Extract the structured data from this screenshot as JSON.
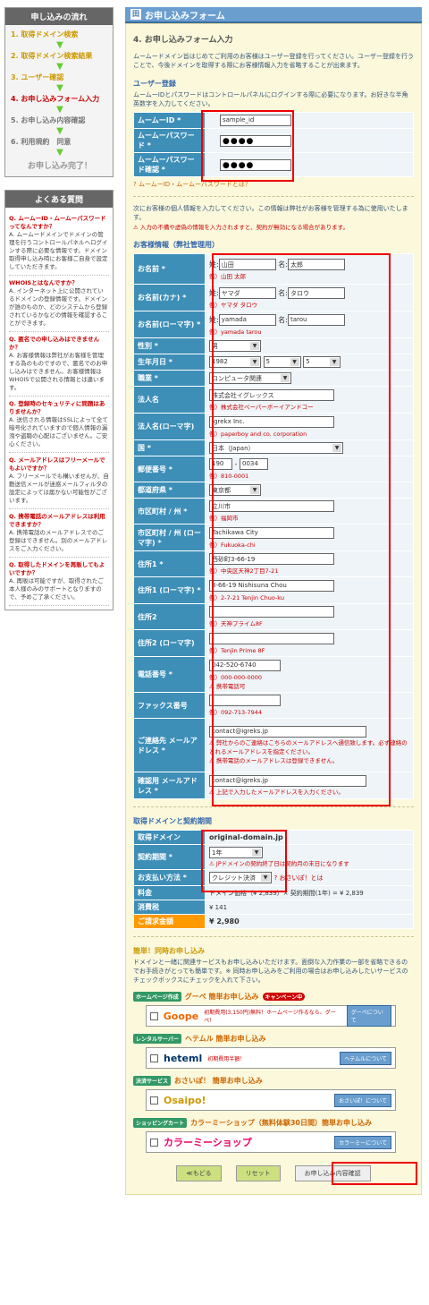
{
  "sidebar": {
    "flow_title": "申し込みの流れ",
    "steps": [
      "1. 取得ドメイン検索",
      "2. 取得ドメイン検索結果",
      "3. ユーザー確認",
      "4. お申し込みフォーム入力",
      "5. お申し込み内容確認",
      "6. 利用規約　同意"
    ],
    "done": "お申し込み完了！",
    "faq_title": "よくある質問",
    "faq": [
      {
        "q": "Q. ムームーID・ムームーパスワードってなんですか？",
        "a": "A. ムームードメインでドメインの管理を行うコントロールパネルへログインする際に必要な情報です。ドメイン取得申し込み時にお客様ご自身で設定していただきます。"
      },
      {
        "q": "WHOISとはなんですか？",
        "a": "A. インターネット上に公開されているドメインの登録情報です。ドメインが誰のものか、どのシステムから登録されているかなどの情報を確認することができます。"
      },
      {
        "q": "Q. 匿名での申し込みはできませんか？",
        "a": "A. お客様情報は弊社がお客様を管理する為のものですので、匿名でのお申し込みはできません。お客様情報はWHOISで公開される情報とは違います。"
      },
      {
        "q": "Q. 登録時のセキュリティに問題はありませんか？",
        "a": "A. 送信される情報はSSLによって全て暗号化されていますので個人情報の漏洩や盗聴の心配はございません。ご安心ください。"
      },
      {
        "q": "Q. メールアドレスはフリーメールでもよいですか？",
        "a": "A. フリーメールでも構いませんが、自動送信メールが迷惑メールフィルタの設定によっては届かない可能性がございます。"
      },
      {
        "q": "Q. 携帯電話のメールアドレスは利用できますか？",
        "a": "A. 携帯電話のメールアドレスでのご登録はできません。別のメールアドレスをご入力ください。"
      },
      {
        "q": "Q. 取得したドメインを再販してもよいですか？",
        "a": "A. 再販は可能ですが、取得されたご本人様のみのサポートとなりますので、予めご了承ください。"
      }
    ]
  },
  "main": {
    "header": "お申し込みフォーム",
    "section_title": "4. お申し込みフォーム入力",
    "intro": "ムームードメイン旨はじめてご利用のお客様はユーザー登録を行ってください。ユーザー登録を行うことで、今後ドメインを取得する際にお客様情報入力を省略することが出来ます。",
    "user_reg_head": "ユーザー登録",
    "user_reg_desc": "ムームーIDとパスワードはコントロールパネルにログインする際に必要になります。お好きな半角英数字を入力してください。",
    "user_fields": [
      {
        "label": "ムームーID *",
        "value": "sample_id"
      },
      {
        "label": "ムームーパスワード *",
        "value": "●●●●"
      },
      {
        "label": "ムームーパスワード確認 *",
        "value": "●●●●"
      }
    ],
    "user_note": "ムームーID・ムームーパスワードとは？",
    "cust_intro": "次にお客様の個人情報を入力してください。この情報は弊社がお客様を管理する為に使用いたします。",
    "cust_warn": "入力の不備や虚偽の情報を入力されますと、契約が無効になる場合があります。",
    "cust_head": "お客様情報（弊社管理用）",
    "cust": {
      "name_sei": "山田",
      "name_mei": "太郎",
      "name_ex": "例）山田 太郎",
      "kana_sei": "ヤマダ",
      "kana_mei": "タロウ",
      "kana_ex": "例）ヤマダ タロウ",
      "roma_sei": "yamada",
      "roma_mei": "tarou",
      "roma_ex": "例）yamada tarou",
      "sex": "男",
      "birth_y": "1982",
      "birth_m": "5",
      "birth_d": "5",
      "job": "コンピュータ関連",
      "corp": "株式会社イグレックス",
      "corp_ex": "例）株式会社ペーパーボーイアンドコー",
      "corp_roma": "Igrekx Inc.",
      "corp_roma_ex": "例）paperboy and co. corporation",
      "country": "日本（Japan）",
      "zip1": "190",
      "zip2": "0034",
      "zip_ex": "例）810-0001",
      "pref": "東京都",
      "city": "立川市",
      "city_ex": "例）福岡市",
      "city_roma": "Tachikawa City",
      "city_roma_ex": "例）Fukuoka-chi",
      "addr1": "西砂町3-66-19",
      "addr1_ex": "例）中央区天神2丁目7-21",
      "addr1_roma": "3-66-19 Nishisuna Chou",
      "addr1_roma_ex": "例）2-7-21 Tenjin Chuo-ku",
      "addr2": "",
      "addr2_ex": "例）天神プライム8F",
      "addr2_roma": "",
      "addr2_roma_ex": "例）Tenjin Prime 8F",
      "tel": "042-520-6740",
      "tel_ex": "例）000-000-0000",
      "tel_note": "携帯電話可",
      "fax": "",
      "fax_ex": "例）092-713-7944",
      "mail": "contact@igreks.jp",
      "mail_note1": "弊社からのご連絡はこちらのメールアドレスへ通信致します。必ず連絡のとれるメールアドレスを指定ください。",
      "mail_note2": "携帯電話のメールアドレスは登録できません。",
      "mail2": "contact@igreks.jp",
      "mail2_note": "上記で入力したメールアドレスを入力ください。"
    },
    "cust_labels": {
      "name": "お名前 *",
      "kana": "お名前(カナ) *",
      "roma": "お名前(ローマ字) *",
      "sex": "性別 *",
      "birth": "生年月日 *",
      "job": "職業 *",
      "corp": "法人名",
      "corp_roma": "法人名(ローマ字)",
      "country": "国 *",
      "zip": "郵便番号 *",
      "pref": "都道府県 *",
      "city": "市区町村 / 州 *",
      "city_roma": "市区町村 / 州 (ローマ字) *",
      "addr1": "住所1 *",
      "addr1_roma": "住所1 (ローマ字) *",
      "addr2": "住所2",
      "addr2_roma": "住所2 (ローマ字)",
      "tel": "電話番号 *",
      "fax": "ファックス番号",
      "mail": "ご連絡先 メールアドレス *",
      "mail2": "確認用 メールアドレス *",
      "sei": "姓:",
      "mei": "名:"
    },
    "domain_head": "取得ドメインと契約期間",
    "domain": {
      "l_domain": "取得ドメイン",
      "domain": "original-domain.jp",
      "l_period": "契約期間 *",
      "period": "1年",
      "period_note": "JPドメインの契約終了日は契約月の末日になります",
      "l_pay": "お支払い方法 *",
      "pay": "クレジット決済",
      "pay_link": "おさいぽ！とは",
      "l_fee": "料金",
      "fee": "ドメイン価格（¥ 2,839）× 契約期間(1年) = ¥ 2,839",
      "l_tax": "消費税",
      "tax": "¥ 141",
      "l_total": "ご請求金額",
      "total": "¥ 2,980"
    },
    "easy_head": "簡単！同時お申し込み",
    "easy_desc": "ドメインと一緒に関連サービスもお申し込みいただけます。面倒な入力作業の一部を省略できるのでお手続きがとっても簡単です。※ 同時お申し込みをご利用の場合はお申し込みしたいサービスのチェックボックスにチェックを入れて下さい。",
    "services": [
      {
        "tag": "ホームページ作成",
        "title": "グーペ 簡単お申し込み",
        "badge": "キャンペーン中",
        "logo": "Goope",
        "desc": "初期費用(3,150円)無料！ホームページ作るなら、グーペ！",
        "detail": "グーペについて"
      },
      {
        "tag": "レンタルサーバー",
        "title": "ヘテムル 簡単お申し込み",
        "badge": "",
        "logo": "heteml",
        "desc": "初期費用半額！",
        "detail": "ヘテムルについて"
      },
      {
        "tag": "決済サービス",
        "title": "おさいぽ！ 簡単お申し込み",
        "badge": "",
        "logo": "Osaipo!",
        "desc": "",
        "detail": "おさいぽ！について"
      },
      {
        "tag": "ショッピングカート",
        "title": "カラーミーショップ（無料体験30日間）簡単お申し込み",
        "badge": "",
        "logo": "カラーミーショップ",
        "desc": "",
        "detail": "カラーミーについて"
      }
    ],
    "btn_back": "≪もどる",
    "btn_reset": "リセット",
    "btn_confirm": "お申し込み内容確認"
  }
}
